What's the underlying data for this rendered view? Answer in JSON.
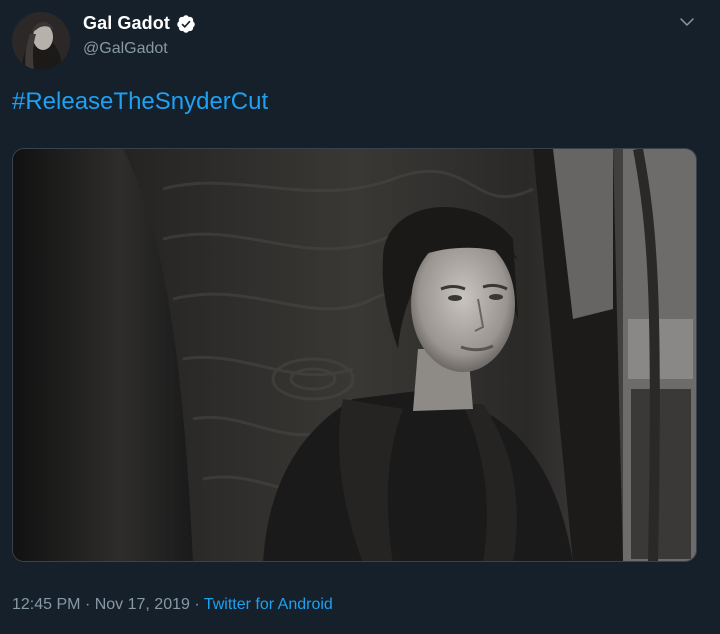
{
  "author": {
    "name": "Gal Gadot",
    "handle": "@GalGadot",
    "verified": true
  },
  "tweet": {
    "text": "#ReleaseTheSnyderCut"
  },
  "media": {
    "alt": "Black-and-white still of a woman in a dark coat sitting inside a vehicle"
  },
  "footer": {
    "time": "12:45 PM",
    "separator1": "·",
    "date": "Nov 17, 2019",
    "separator2": "·",
    "source": "Twitter for Android"
  },
  "icons": {
    "verified": "verified-badge-icon",
    "menu": "chevron-down-icon"
  },
  "colors": {
    "background": "#15202b",
    "link": "#1da1f2",
    "secondary_text": "#8899a6",
    "primary_text": "#ffffff"
  }
}
